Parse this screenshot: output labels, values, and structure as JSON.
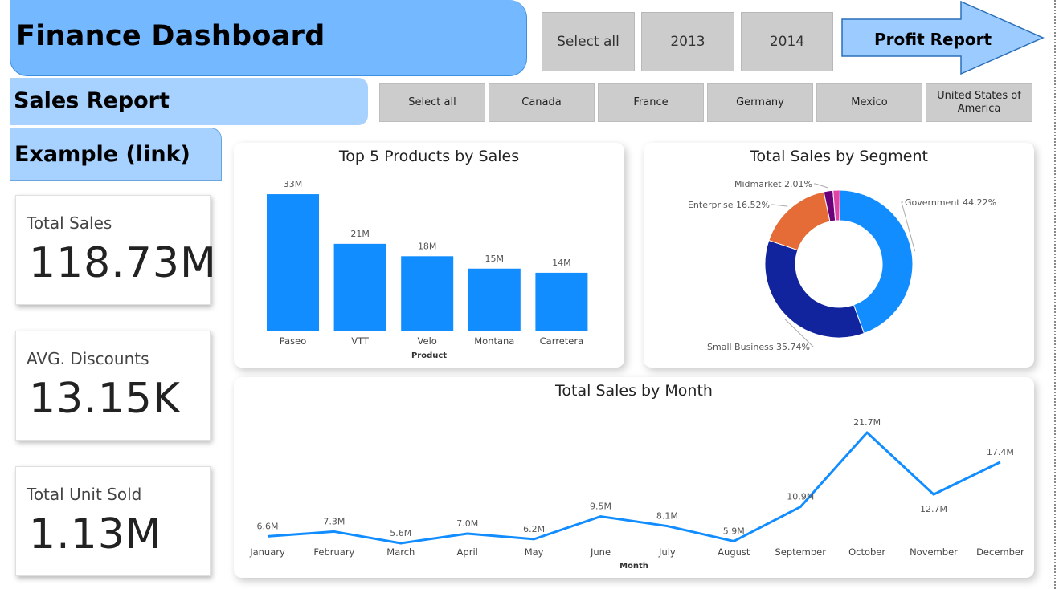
{
  "header": {
    "title": "Finance Dashboard",
    "profit_button": "Profit Report"
  },
  "nav": {
    "sales_report": "Sales Report",
    "example_link": "Example (link)"
  },
  "year_filter": [
    "Select all",
    "2013",
    "2014"
  ],
  "country_filter": [
    "Select all",
    "Canada",
    "France",
    "Germany",
    "Mexico",
    "United States of America"
  ],
  "kpis": [
    {
      "label": "Total Sales",
      "value": "118.73M"
    },
    {
      "label": "AVG. Discounts",
      "value": "13.15K"
    },
    {
      "label": "Total Unit Sold",
      "value": "1.13M"
    }
  ],
  "colors": {
    "accent": "#118dff",
    "banner": "#74b8ff",
    "banner_light": "#a7d1ff",
    "slicer": "#cccccc"
  },
  "chart_data": [
    {
      "type": "bar",
      "title": "Top 5 Products by Sales",
      "xlabel": "Product",
      "categories": [
        "Paseo",
        "VTT",
        "Velo",
        "Montana",
        "Carretera"
      ],
      "values": [
        33,
        21,
        18,
        15,
        14
      ],
      "data_labels": [
        "33M",
        "21M",
        "18M",
        "15M",
        "14M"
      ],
      "ylim": [
        0,
        34
      ],
      "color": "#118dff"
    },
    {
      "type": "pie",
      "title": "Total Sales by Segment",
      "slices": [
        {
          "label": "Government 44.22%",
          "value": 44.22,
          "color": "#118dff"
        },
        {
          "label": "Small Business 35.74%",
          "value": 35.74,
          "color": "#12239e"
        },
        {
          "label": "Enterprise 16.52%",
          "value": 16.52,
          "color": "#e66c37"
        },
        {
          "label": "Midmarket 2.01%",
          "value": 2.01,
          "color": "#6b007b"
        },
        {
          "label": "",
          "value": 1.51,
          "color": "#e044a7"
        }
      ]
    },
    {
      "type": "line",
      "title": "Total Sales by Month",
      "xlabel": "Month",
      "categories": [
        "January",
        "February",
        "March",
        "April",
        "May",
        "June",
        "July",
        "August",
        "September",
        "October",
        "November",
        "December"
      ],
      "values": [
        6.6,
        7.3,
        5.6,
        7.0,
        6.2,
        9.5,
        8.1,
        5.9,
        10.9,
        21.7,
        12.7,
        17.4
      ],
      "data_labels": [
        "6.6M",
        "7.3M",
        "5.6M",
        "7.0M",
        "6.2M",
        "9.5M",
        "8.1M",
        "5.9M",
        "10.9M",
        "21.7M",
        "12.7M",
        "17.4M"
      ],
      "ylim": [
        0,
        22
      ],
      "color": "#118dff"
    }
  ]
}
